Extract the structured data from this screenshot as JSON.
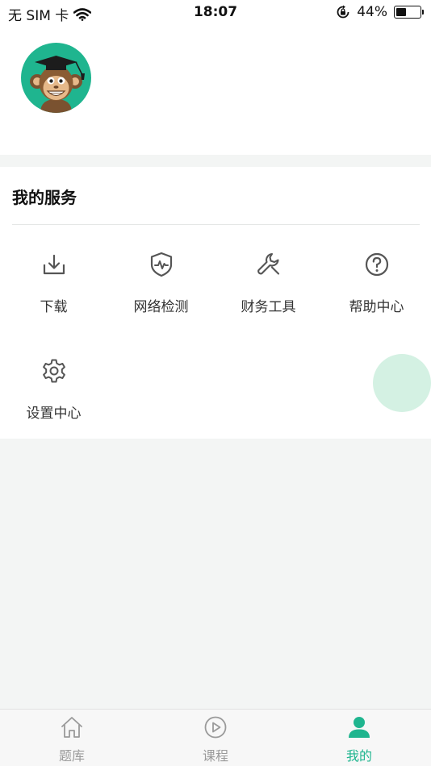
{
  "status_bar": {
    "carrier": "无 SIM 卡",
    "time": "18:07",
    "battery": "44%",
    "battery_level": 0.44
  },
  "profile": {
    "avatar_icon": "monkey-graduate-avatar",
    "avatar_bg": "#1fb58f"
  },
  "services": {
    "title": "我的服务",
    "items": [
      {
        "label": "下载",
        "icon": "download-icon"
      },
      {
        "label": "网络检测",
        "icon": "shield-pulse-icon"
      },
      {
        "label": "财务工具",
        "icon": "wrench-icon"
      },
      {
        "label": "帮助中心",
        "icon": "help-circle-icon"
      },
      {
        "label": "设置中心",
        "icon": "gear-icon"
      }
    ]
  },
  "tabbar": {
    "tabs": [
      {
        "label": "题库",
        "icon": "home-icon",
        "active": false
      },
      {
        "label": "课程",
        "icon": "play-circle-icon",
        "active": false
      },
      {
        "label": "我的",
        "icon": "person-icon",
        "active": true
      }
    ]
  },
  "colors": {
    "accent": "#1fb58f",
    "page_bg": "#f3f5f4",
    "fab_bg": "#d4f1e3"
  }
}
